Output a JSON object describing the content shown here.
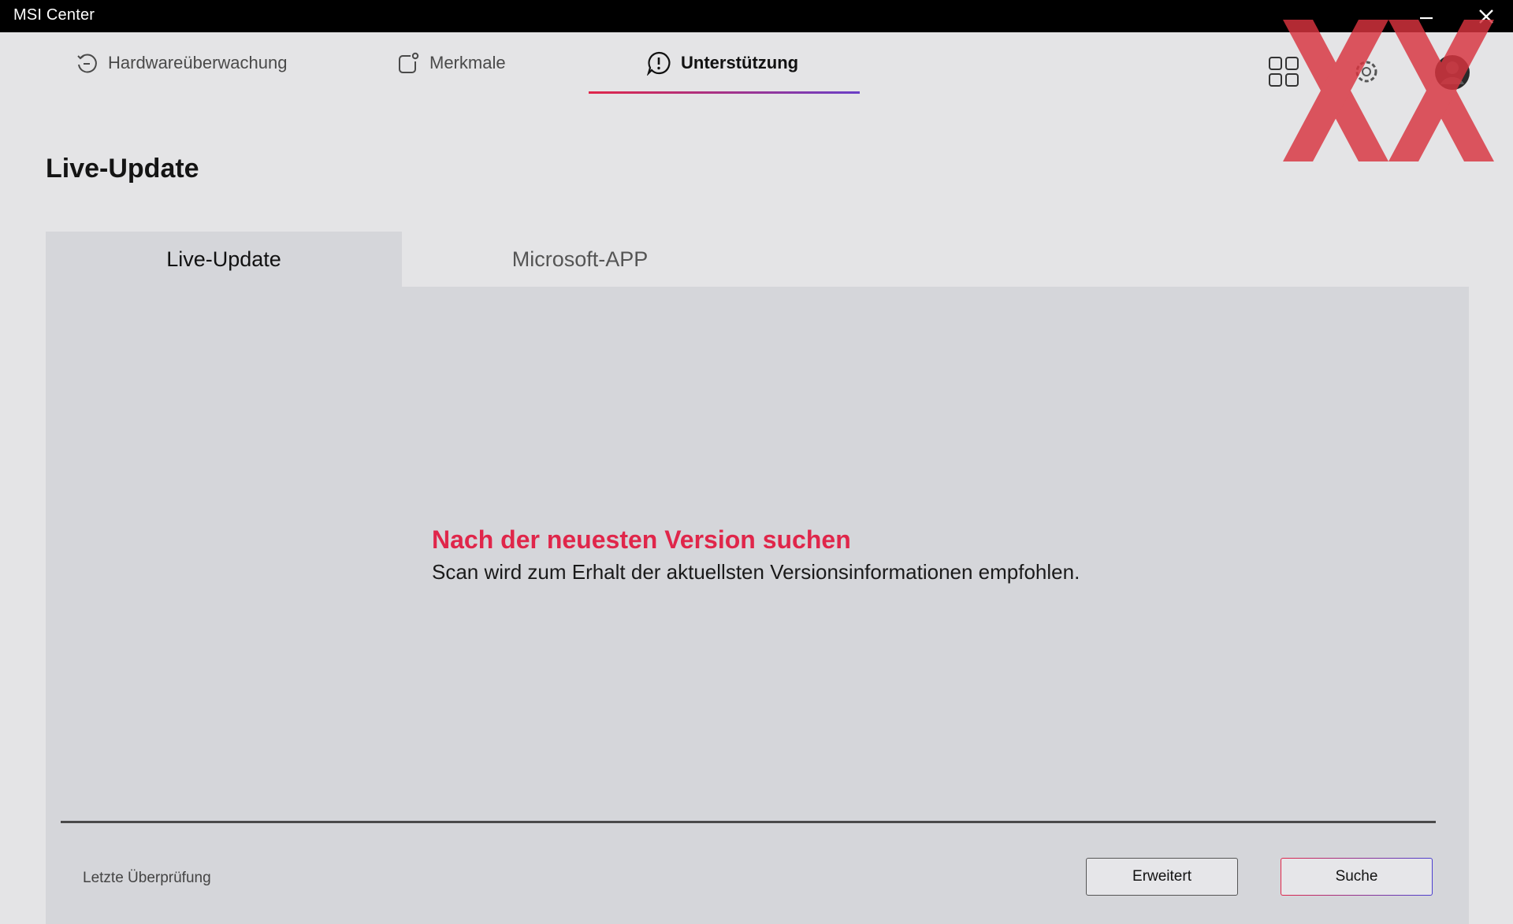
{
  "window": {
    "title": "MSI Center",
    "controls": [
      "minimize-icon",
      "close-icon"
    ]
  },
  "nav": {
    "tabs": [
      {
        "label": "Hardwareüberwachung",
        "icon": "refresh-circle-icon",
        "active": false
      },
      {
        "label": "Merkmale",
        "icon": "feature-icon",
        "active": false
      },
      {
        "label": "Unterstützung",
        "icon": "alert-bubble-icon",
        "active": true
      }
    ],
    "right_icons": [
      "grid-icon",
      "gear-icon",
      "avatar"
    ]
  },
  "page": {
    "title": "Live-Update"
  },
  "subtabs": [
    {
      "label": "Live-Update",
      "active": true
    },
    {
      "label": "Microsoft-APP",
      "active": false
    }
  ],
  "panel": {
    "headline": "Nach der neuesten Version suchen",
    "subline": "Scan wird zum Erhalt der aktuellsten Versionsinformationen empfohlen.",
    "last_check_label": "Letzte Überprüfung",
    "buttons": {
      "advanced": "Erweitert",
      "search": "Suche"
    }
  },
  "colors": {
    "accent_red": "#e0264a",
    "accent_purple": "#4b3fd0",
    "titlebar_bg": "#000000",
    "background": "#e4e4e6",
    "panel_bg": "#d5d6da"
  }
}
